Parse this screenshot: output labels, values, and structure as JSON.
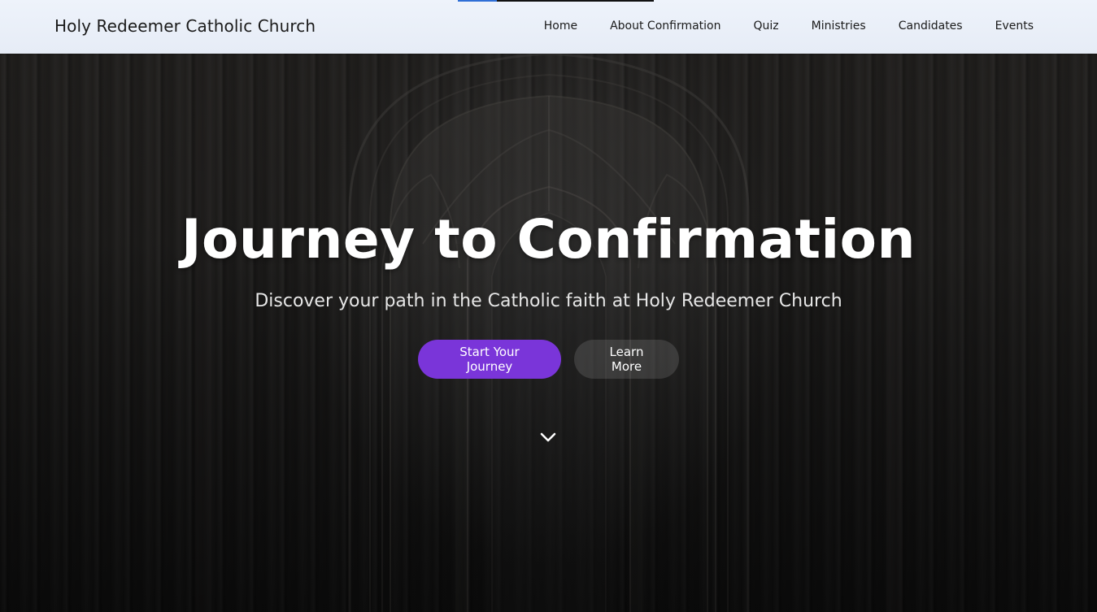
{
  "site": {
    "brand": "Holy Redeemer Catholic Church"
  },
  "nav": {
    "items": [
      {
        "label": "Home"
      },
      {
        "label": "About Confirmation"
      },
      {
        "label": "Quiz"
      },
      {
        "label": "Ministries"
      },
      {
        "label": "Candidates"
      },
      {
        "label": "Events"
      }
    ]
  },
  "hero": {
    "title": "Journey to Confirmation",
    "subtitle": "Discover your path in the Catholic faith at Holy Redeemer Church",
    "primary_cta": "Start Your Journey",
    "secondary_cta": "Learn More",
    "scroll_icon": "chevron-down-icon"
  },
  "loader": {
    "progress": 0.2
  },
  "colors": {
    "accent": "#7a35d9",
    "navbar_bg": "#e9eef7",
    "hero_bg": "#1c1b1a",
    "loader_fill": "#2f6fd6"
  }
}
